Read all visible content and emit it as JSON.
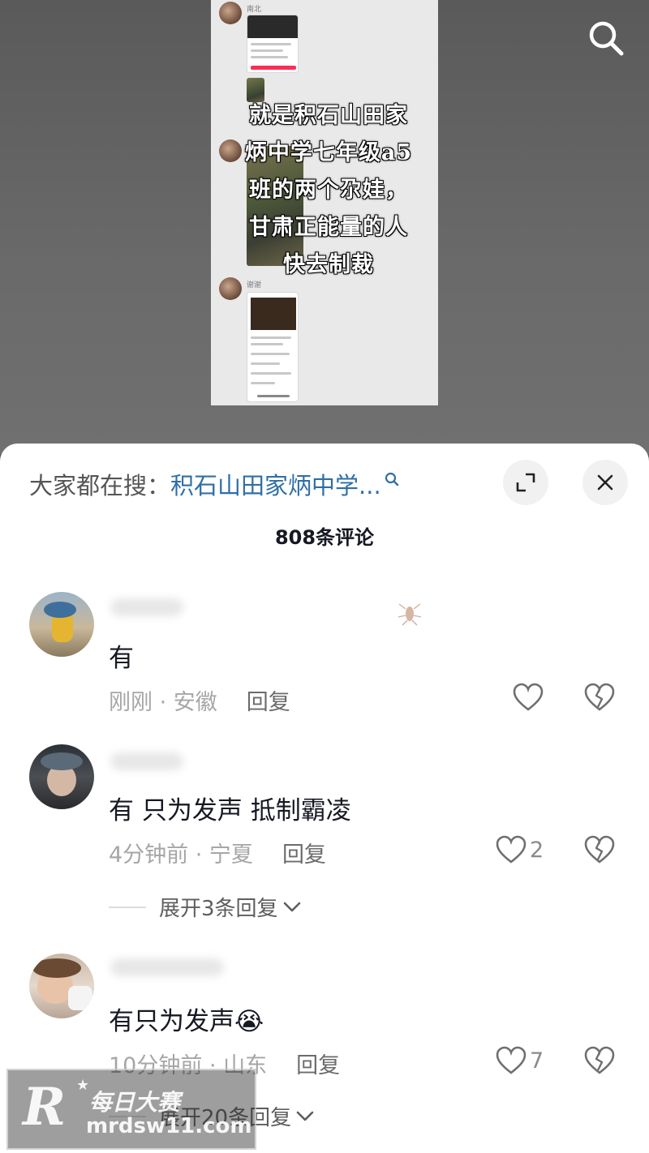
{
  "video": {
    "overlay_lines": [
      "就是积石山田家",
      "炳中学七年级a5",
      "班的两个尕娃，",
      "甘肃正能量的人",
      "快去制裁"
    ],
    "chat_names": [
      "南北",
      "谢谢"
    ]
  },
  "comments_panel": {
    "search_prefix": "大家都在搜：",
    "search_term": "积石山田家炳中学...",
    "comment_count": "808条评论",
    "comments": [
      {
        "text": "有",
        "time_location": "刚刚 · 安徽",
        "reply_label": "回复",
        "likes": ""
      },
      {
        "text": "有 只为发声 抵制霸凌",
        "time_location": "4分钟前 · 宁夏",
        "reply_label": "回复",
        "likes": "2",
        "expand_label": "展开3条回复"
      },
      {
        "text": "有只为发声😭",
        "time_location": "10分钟前 · 山东",
        "reply_label": "回复",
        "likes": "7",
        "expand_label": "展开20条回复"
      }
    ]
  },
  "watermark": {
    "logo": "R",
    "name": "每日大赛",
    "url": "mrdsw11.com"
  },
  "colors": {
    "search_term": "#2f6fa5",
    "brand_pink": "#fe2c55"
  }
}
